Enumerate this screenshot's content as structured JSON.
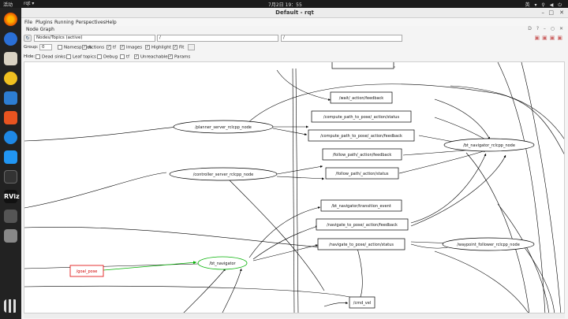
{
  "topbar": {
    "activities": "活动",
    "app": "rqt ▾",
    "clock": "7月2日 19：55",
    "tray": "英 ▾ ⚲ ◀ ⏻"
  },
  "window": {
    "title": "Default - rqt",
    "minimize": "–",
    "maximize": "□",
    "close": "✕"
  },
  "menu": {
    "file": "File",
    "plugins": "Plugins",
    "running": "Running",
    "perspectives": "Perspectives",
    "help": "Help"
  },
  "plugin": {
    "title": "Node Graph",
    "buttons": "D ? – ○ ✕"
  },
  "toolbar": {
    "refresh_icon": "↻",
    "mode_select": "Nodes/Topics (active)",
    "filter1": "/",
    "filter2": "/"
  },
  "group": {
    "label": "Group:",
    "value": "0",
    "namespaces": "Namespaces",
    "actions": "Actions",
    "tf": "tf",
    "images": "Images",
    "highlight": "Highlight",
    "fit": "Fit"
  },
  "hide": {
    "label": "Hide:",
    "dead_sinks": "Dead sinks",
    "leaf_topics": "Leaf topics",
    "debug": "Debug",
    "tf": "tf",
    "unreachable": "Unreachable",
    "params": "Params"
  },
  "checks": {
    "namespaces": false,
    "actions": true,
    "tf": true,
    "images": true,
    "highlight": true,
    "fit": true,
    "dead_sinks": false,
    "leaf_topics": false,
    "debug": false,
    "tf_hide": false,
    "unreachable": true,
    "params": true
  },
  "graph": {
    "nodes": {
      "planner": "/planner_server_rclcpp_node",
      "controller": "/controller_server_rclcpp_node",
      "bt_nav_node": "/bt_navigator_rclcpp_node",
      "waypoint": "/waypoint_follower_rclcpp_node",
      "bt_navigator": "/bt_navigator",
      "goal_pose": "/goal_pose"
    },
    "topics": {
      "wait_feedback": "/wait/_action/feedback",
      "compute_status": "/compute_path_to_pose/_action/status",
      "compute_feedback": "/compute_path_to_pose/_action/feedback",
      "follow_feedback": "/follow_path/_action/feedback",
      "follow_status": "/follow_path/_action/status",
      "transition_event": "/bt_navigator/transition_event",
      "nav_feedback": "/navigate_to_pose/_action/feedback",
      "nav_status": "/navigate_to_pose/_action/status",
      "cmd_vel": "/cmd_vel"
    },
    "colors": {
      "goal_pose": "#e00000",
      "bt_navigator": "#00b000",
      "default": "#000000"
    }
  }
}
